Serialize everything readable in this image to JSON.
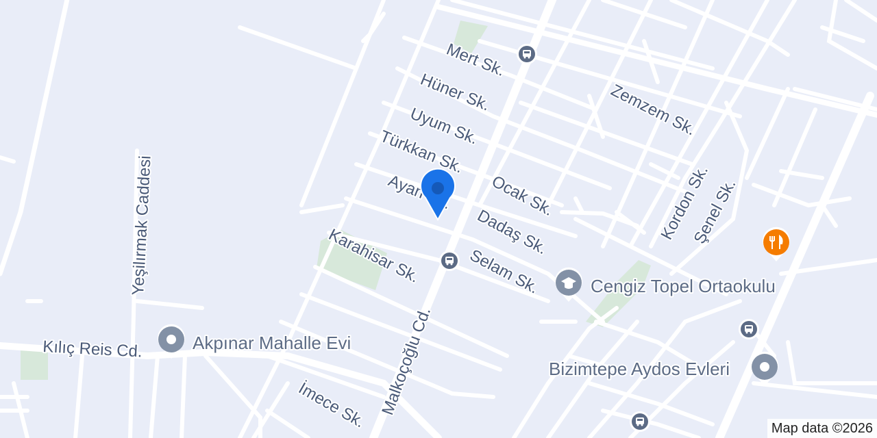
{
  "map": {
    "colors": {
      "background": "#e9edf8",
      "road": "#ffffff",
      "park": "#d7e8da",
      "label": "#4a5a78",
      "poi_marker": "#8391a6",
      "restaurant_marker": "#f57c00",
      "location_pin": "#1a73e8"
    },
    "streets": {
      "mert": "Mert Sk.",
      "huner": "Hüner Sk.",
      "uyum": "Uyum Sk.",
      "turkkan": "Türkkan Sk.",
      "ayan": "Ayan Sk.",
      "ocak": "Ocak Sk.",
      "dadas": "Dadaş Sk.",
      "selam": "Selam Sk.",
      "karahisar": "Karahisar Sk.",
      "zemzem": "Zemzem Sk.",
      "kordon": "Kordon Sk.",
      "senel": "Şenel Sk.",
      "yesilirmak": "Yeşilırmak Caddesi",
      "kilic_reis": "Kılıç Reis Cd.",
      "malkocoglu": "Malkoçoğlu Cd.",
      "imece": "İmece Sk."
    },
    "places": {
      "cengiz_topel": "Cengiz Topel Ortaokulu",
      "akpinar": "Akpınar Mahalle Evi",
      "bizimtepe": "Bizimtepe Aydos Evleri"
    },
    "icons": {
      "bus_stop": "bus-stop-icon",
      "school": "school-icon",
      "place": "place-icon",
      "restaurant": "restaurant-icon",
      "location": "location-pin-icon"
    },
    "attribution": "Map data ©2026"
  }
}
